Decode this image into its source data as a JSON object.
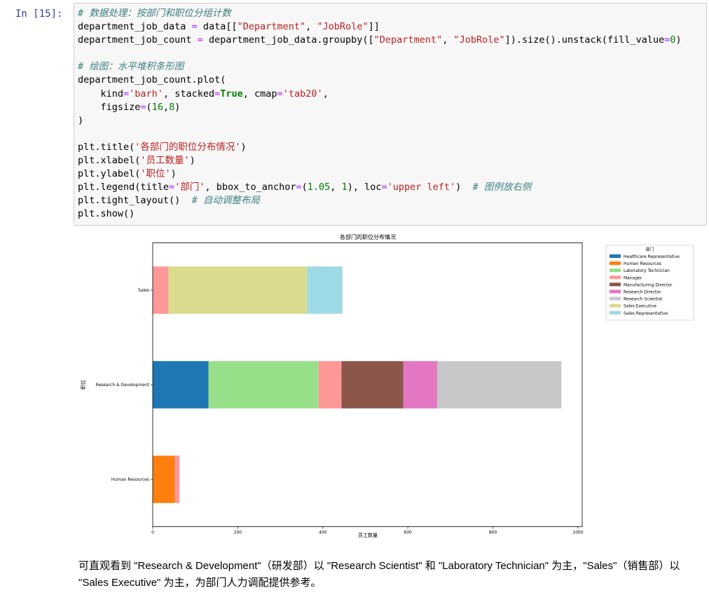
{
  "cell": {
    "prompt": "In  [15]:",
    "lines": [
      [
        {
          "t": "# 数据处理：按部门和职位分组计数",
          "c": "com"
        }
      ],
      [
        {
          "t": "department_job_data "
        },
        {
          "t": "=",
          "c": "op"
        },
        {
          "t": " data[["
        },
        {
          "t": "\"Department\"",
          "c": "str"
        },
        {
          "t": ", "
        },
        {
          "t": "\"JobRole\"",
          "c": "str"
        },
        {
          "t": "]]"
        }
      ],
      [
        {
          "t": "department_job_count "
        },
        {
          "t": "=",
          "c": "op"
        },
        {
          "t": " department_job_data.groupby(["
        },
        {
          "t": "\"Department\"",
          "c": "str"
        },
        {
          "t": ", "
        },
        {
          "t": "\"JobRole\"",
          "c": "str"
        },
        {
          "t": "]).size().unstack(fill_value"
        },
        {
          "t": "=",
          "c": "op"
        },
        {
          "t": "0",
          "c": "num"
        },
        {
          "t": ")"
        }
      ],
      [
        {
          "t": ""
        }
      ],
      [
        {
          "t": "# 绘图：水平堆积条形图",
          "c": "com"
        }
      ],
      [
        {
          "t": "department_job_count.plot("
        }
      ],
      [
        {
          "t": "    kind"
        },
        {
          "t": "=",
          "c": "op"
        },
        {
          "t": "'barh'",
          "c": "str"
        },
        {
          "t": ", stacked"
        },
        {
          "t": "=",
          "c": "op"
        },
        {
          "t": "True",
          "c": "kw"
        },
        {
          "t": ", cmap"
        },
        {
          "t": "=",
          "c": "op"
        },
        {
          "t": "'tab20'",
          "c": "str"
        },
        {
          "t": ","
        }
      ],
      [
        {
          "t": "    figsize"
        },
        {
          "t": "=",
          "c": "op"
        },
        {
          "t": "("
        },
        {
          "t": "16",
          "c": "num"
        },
        {
          "t": ","
        },
        {
          "t": "8",
          "c": "num"
        },
        {
          "t": ")"
        }
      ],
      [
        {
          "t": ")"
        }
      ],
      [
        {
          "t": ""
        }
      ],
      [
        {
          "t": "plt.title("
        },
        {
          "t": "'各部门的职位分布情况'",
          "c": "str"
        },
        {
          "t": ")"
        }
      ],
      [
        {
          "t": "plt.xlabel("
        },
        {
          "t": "'员工数量'",
          "c": "str"
        },
        {
          "t": ")"
        }
      ],
      [
        {
          "t": "plt.ylabel("
        },
        {
          "t": "'职位'",
          "c": "str"
        },
        {
          "t": ")"
        }
      ],
      [
        {
          "t": "plt.legend(title"
        },
        {
          "t": "=",
          "c": "op"
        },
        {
          "t": "'部门'",
          "c": "str"
        },
        {
          "t": ", bbox_to_anchor"
        },
        {
          "t": "=",
          "c": "op"
        },
        {
          "t": "("
        },
        {
          "t": "1.05",
          "c": "num"
        },
        {
          "t": ", "
        },
        {
          "t": "1",
          "c": "num"
        },
        {
          "t": "), loc"
        },
        {
          "t": "=",
          "c": "op"
        },
        {
          "t": "'upper left'",
          "c": "str"
        },
        {
          "t": ")  "
        },
        {
          "t": "# 图例放右侧",
          "c": "com"
        }
      ],
      [
        {
          "t": "plt.tight_layout()  "
        },
        {
          "t": "# 自动调整布局",
          "c": "com"
        }
      ],
      [
        {
          "t": "plt.show()"
        }
      ]
    ]
  },
  "chart_data": {
    "type": "bar",
    "orientation": "horizontal",
    "stacked": true,
    "title": "各部门的职位分布情况",
    "xlabel": "员工数量",
    "ylabel": "职位",
    "legend_title": "部门",
    "legend_position": "top-right, outside plot",
    "grid": false,
    "xlim": [
      0,
      1010
    ],
    "xticks": [
      0,
      200,
      400,
      600,
      800,
      1000
    ],
    "categories": [
      "Human Resources",
      "Research & Development",
      "Sales"
    ],
    "series": [
      {
        "name": "Healthcare Representative",
        "color": "#1f77b4",
        "values": [
          0,
          131,
          0
        ]
      },
      {
        "name": "Human Resources",
        "color": "#ff7f0e",
        "values": [
          52,
          0,
          0
        ]
      },
      {
        "name": "Laboratory Technician",
        "color": "#98df8a",
        "values": [
          0,
          259,
          0
        ]
      },
      {
        "name": "Manager",
        "color": "#ff9896",
        "values": [
          11,
          54,
          37
        ]
      },
      {
        "name": "Manufacturing Director",
        "color": "#8c564b",
        "values": [
          0,
          145,
          0
        ]
      },
      {
        "name": "Research Director",
        "color": "#e377c2",
        "values": [
          0,
          80,
          0
        ]
      },
      {
        "name": "Research Scientist",
        "color": "#c7c7c7",
        "values": [
          0,
          292,
          0
        ]
      },
      {
        "name": "Sales Executive",
        "color": "#dbdb8d",
        "values": [
          0,
          0,
          326
        ]
      },
      {
        "name": "Sales Representative",
        "color": "#9edae5",
        "values": [
          0,
          0,
          83
        ]
      }
    ]
  },
  "markdown": {
    "text": "可直观看到 \"Research & Development\"（研发部）以 \"Research Scientist\" 和 \"Laboratory Technician\" 为主，\"Sales\"（销售部）以 \"Sales Executive\" 为主，为部门人力调配提供参考。"
  }
}
